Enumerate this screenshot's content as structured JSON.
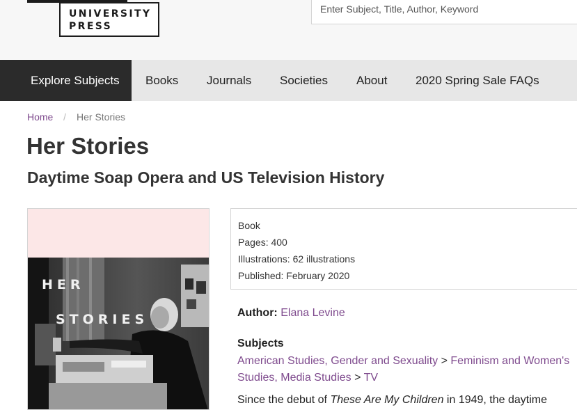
{
  "header": {
    "logo_line1": "UNIVERSITY",
    "logo_line2": "PRESS",
    "search_placeholder": "Enter Subject, Title, Author, Keyword"
  },
  "nav": {
    "items": [
      {
        "label": "Explore Subjects",
        "active": true
      },
      {
        "label": "Books",
        "active": false
      },
      {
        "label": "Journals",
        "active": false
      },
      {
        "label": "Societies",
        "active": false
      },
      {
        "label": "About",
        "active": false
      },
      {
        "label": "2020 Spring Sale FAQs",
        "active": false
      }
    ]
  },
  "breadcrumb": {
    "home": "Home",
    "separator": "/",
    "current": "Her Stories"
  },
  "book": {
    "title": "Her Stories",
    "subtitle": "Daytime Soap Opera and US Television History",
    "cover": {
      "word1": "HER",
      "word2": "STORIES"
    },
    "details": {
      "format": "Book",
      "pages": "Pages: 400",
      "illustrations": "Illustrations: 62 illustrations",
      "published": "Published: February 2020"
    },
    "author_label": "Author:",
    "author_name": "Elana Levine",
    "subjects_heading": "Subjects",
    "subjects": {
      "s1": "American Studies, Gender and Sexuality",
      "sep1": " > ",
      "s2": "Feminism and Women's Studies, Media Studies",
      "sep2": " > ",
      "s3": "TV"
    },
    "description": {
      "part1": "Since the debut of ",
      "italic": "These Are My Children",
      "part2": " in 1949, the daytime"
    }
  },
  "colors": {
    "accent": "#7f4b8e",
    "nav_active": "#2b2b2b",
    "nav_bg": "#e7e7e7",
    "cover_top": "#fce7e7"
  }
}
